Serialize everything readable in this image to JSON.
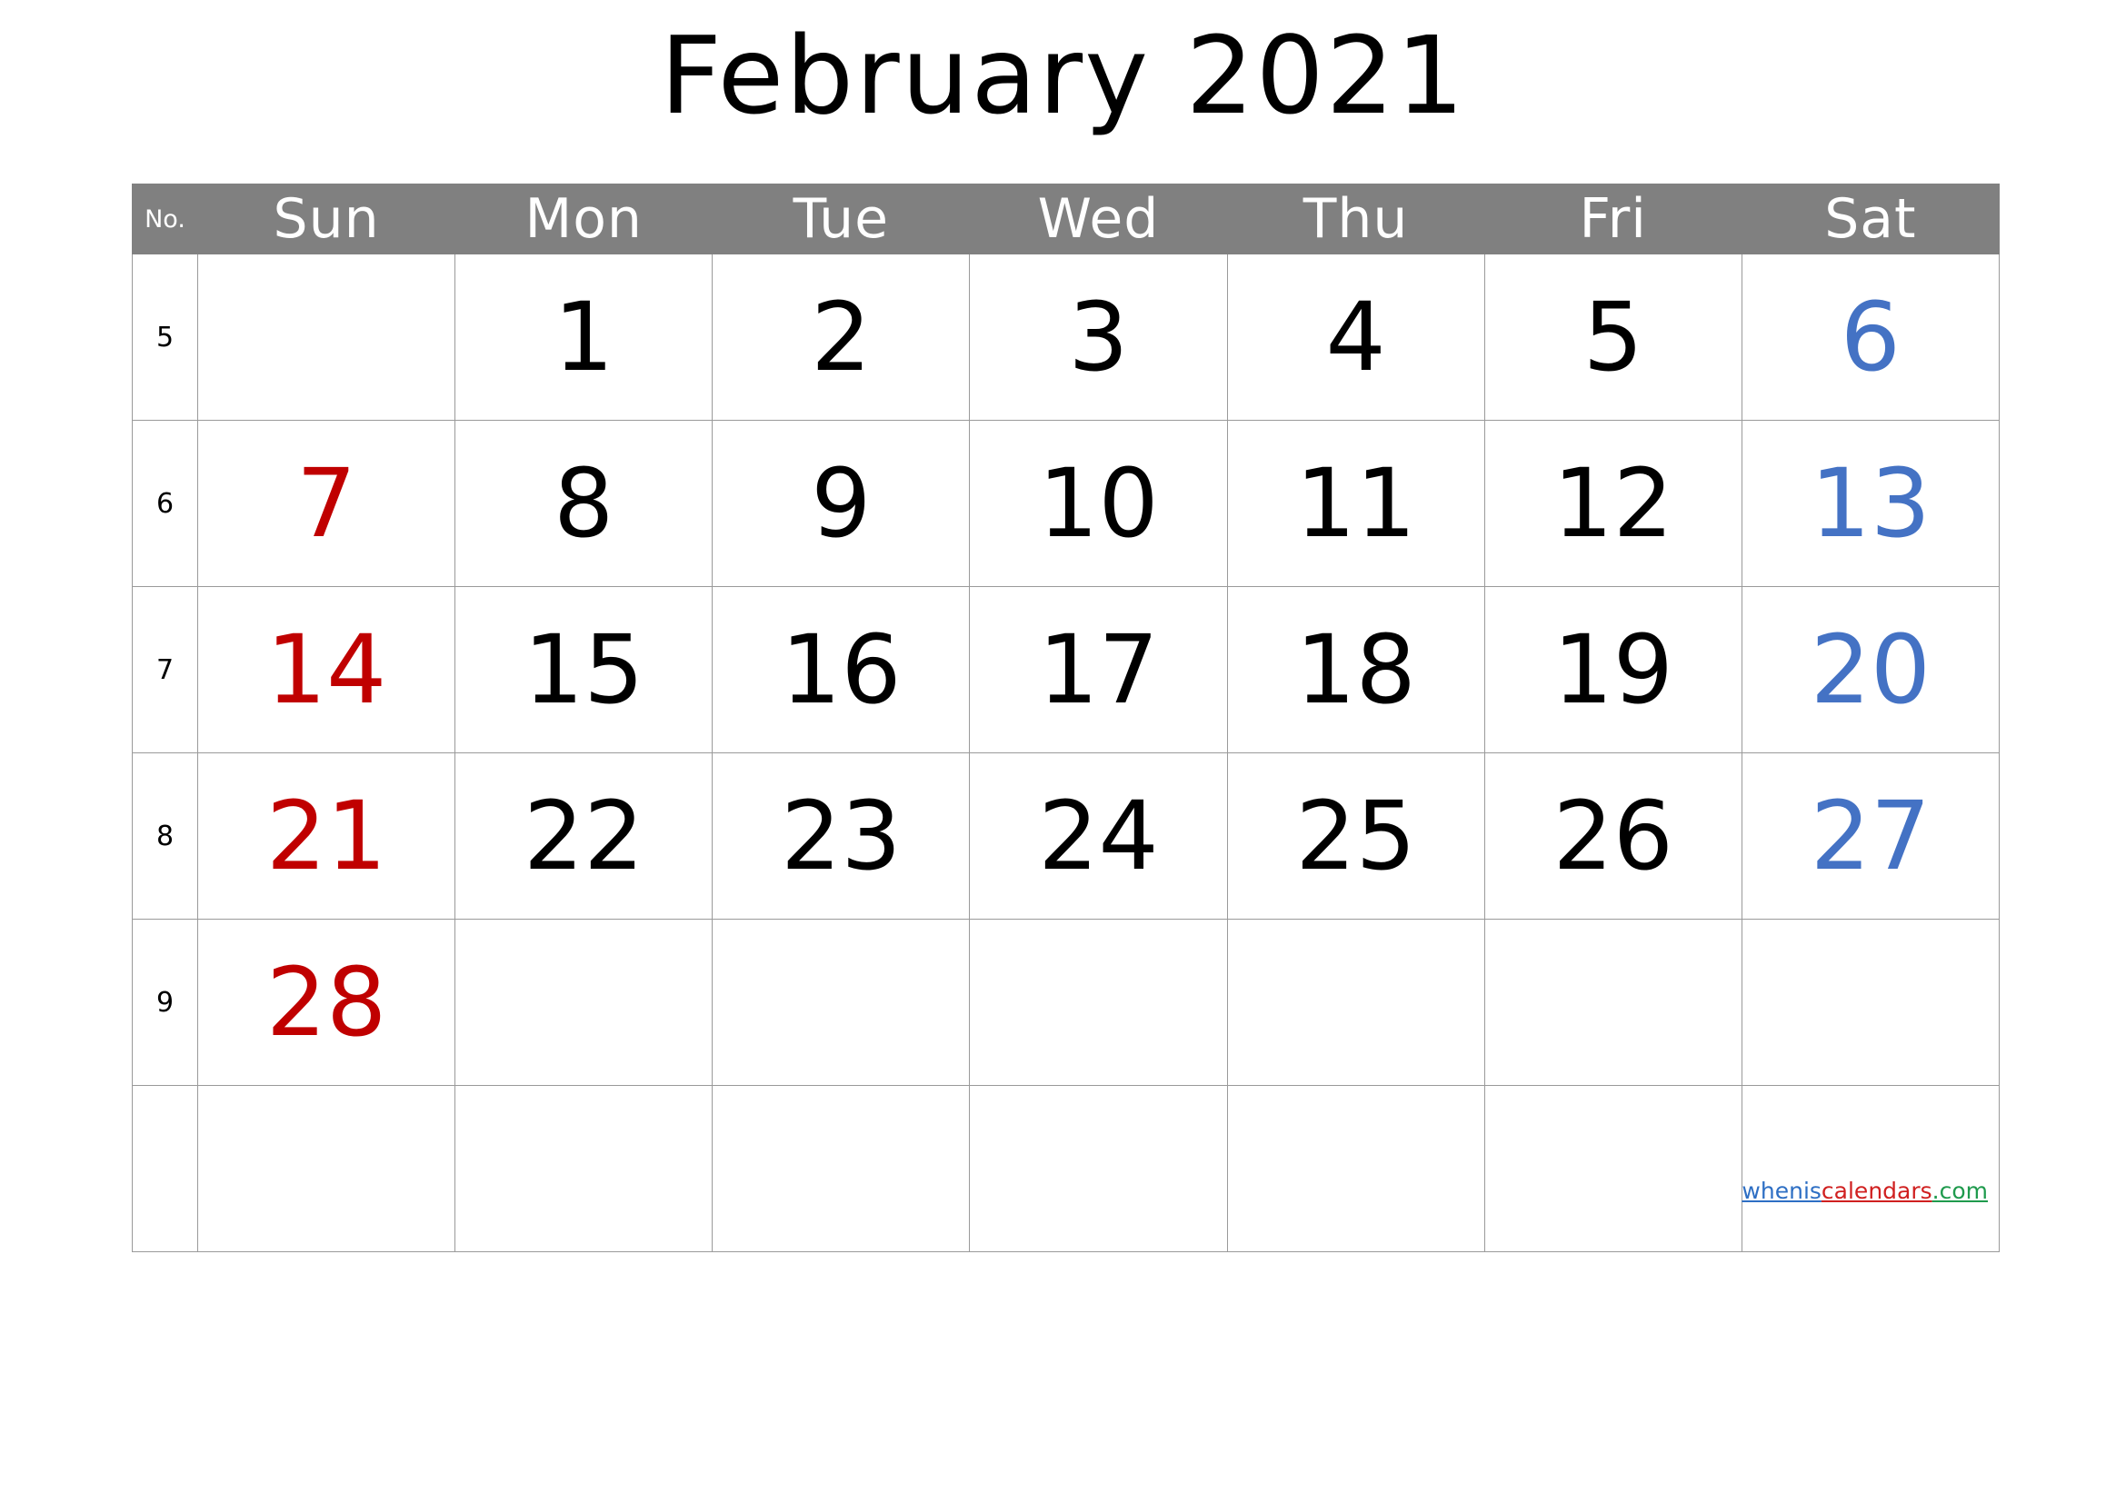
{
  "title": "February 2021",
  "header": {
    "week_no_label": "No.",
    "days": [
      "Sun",
      "Mon",
      "Tue",
      "Wed",
      "Thu",
      "Fri",
      "Sat"
    ]
  },
  "colors": {
    "header_background": "#808080",
    "header_text": "#ffffff",
    "weekday": "#000000",
    "sunday": "#c00000",
    "saturday": "#4472c4",
    "grid_line": "#9a9a9a",
    "page_background": "#ffffff"
  },
  "weeks": [
    {
      "no": "5",
      "days": [
        {
          "label": "",
          "color": "weekday"
        },
        {
          "label": "1",
          "color": "weekday"
        },
        {
          "label": "2",
          "color": "weekday"
        },
        {
          "label": "3",
          "color": "weekday"
        },
        {
          "label": "4",
          "color": "weekday"
        },
        {
          "label": "5",
          "color": "weekday"
        },
        {
          "label": "6",
          "color": "saturday"
        }
      ]
    },
    {
      "no": "6",
      "days": [
        {
          "label": "7",
          "color": "sunday"
        },
        {
          "label": "8",
          "color": "weekday"
        },
        {
          "label": "9",
          "color": "weekday"
        },
        {
          "label": "10",
          "color": "weekday"
        },
        {
          "label": "11",
          "color": "weekday"
        },
        {
          "label": "12",
          "color": "weekday"
        },
        {
          "label": "13",
          "color": "saturday"
        }
      ]
    },
    {
      "no": "7",
      "days": [
        {
          "label": "14",
          "color": "sunday"
        },
        {
          "label": "15",
          "color": "weekday"
        },
        {
          "label": "16",
          "color": "weekday"
        },
        {
          "label": "17",
          "color": "weekday"
        },
        {
          "label": "18",
          "color": "weekday"
        },
        {
          "label": "19",
          "color": "weekday"
        },
        {
          "label": "20",
          "color": "saturday"
        }
      ]
    },
    {
      "no": "8",
      "days": [
        {
          "label": "21",
          "color": "sunday"
        },
        {
          "label": "22",
          "color": "weekday"
        },
        {
          "label": "23",
          "color": "weekday"
        },
        {
          "label": "24",
          "color": "weekday"
        },
        {
          "label": "25",
          "color": "weekday"
        },
        {
          "label": "26",
          "color": "weekday"
        },
        {
          "label": "27",
          "color": "saturday"
        }
      ]
    },
    {
      "no": "9",
      "days": [
        {
          "label": "28",
          "color": "sunday"
        },
        {
          "label": "",
          "color": "weekday"
        },
        {
          "label": "",
          "color": "weekday"
        },
        {
          "label": "",
          "color": "weekday"
        },
        {
          "label": "",
          "color": "weekday"
        },
        {
          "label": "",
          "color": "weekday"
        },
        {
          "label": "",
          "color": "saturday"
        }
      ]
    },
    {
      "no": "",
      "days": [
        {
          "label": "",
          "color": "weekday"
        },
        {
          "label": "",
          "color": "weekday"
        },
        {
          "label": "",
          "color": "weekday"
        },
        {
          "label": "",
          "color": "weekday"
        },
        {
          "label": "",
          "color": "weekday"
        },
        {
          "label": "",
          "color": "weekday"
        },
        {
          "label": "",
          "color": "saturday"
        }
      ]
    }
  ],
  "watermark": {
    "part1": "whenis",
    "part2": "calendars",
    "part3": ".com"
  }
}
